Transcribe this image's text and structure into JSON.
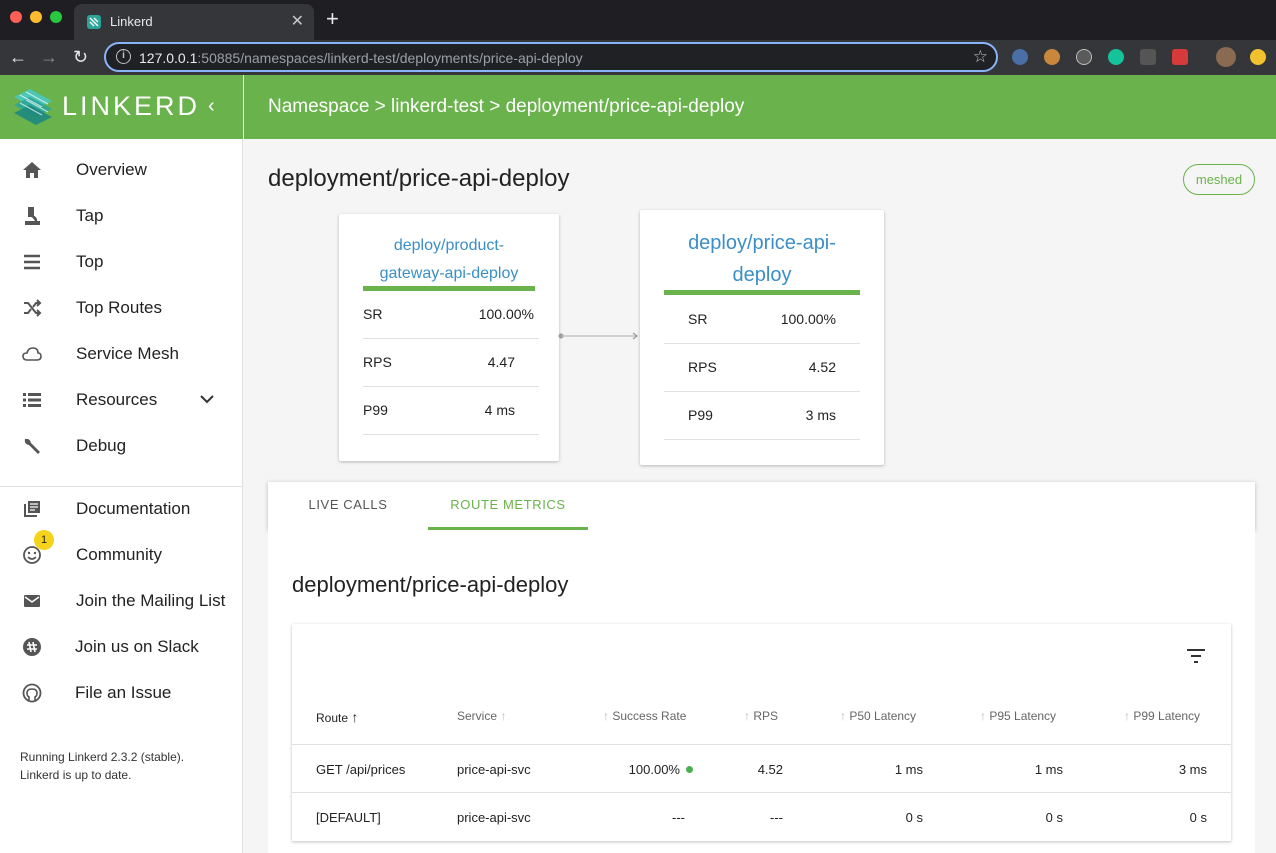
{
  "browser": {
    "tab_title": "Linkerd",
    "url_host": "127.0.0.1",
    "url_rest": ":50885/namespaces/linkerd-test/deployments/price-api-deploy"
  },
  "sidebar": {
    "logo_text": "LINKERD",
    "items": [
      {
        "label": "Overview",
        "icon": "home-icon"
      },
      {
        "label": "Tap",
        "icon": "microscope-icon"
      },
      {
        "label": "Top",
        "icon": "list-lines-icon"
      },
      {
        "label": "Top Routes",
        "icon": "shuffle-icon"
      },
      {
        "label": "Service Mesh",
        "icon": "cloud-icon"
      },
      {
        "label": "Resources",
        "icon": "list-icon"
      },
      {
        "label": "Debug",
        "icon": "wrench-icon"
      }
    ],
    "links": [
      {
        "label": "Documentation",
        "icon": "library-icon"
      },
      {
        "label": "Community",
        "icon": "smiley-icon",
        "badge": "1"
      },
      {
        "label": "Join the Mailing List",
        "icon": "mail-icon"
      },
      {
        "label": "Join us on Slack",
        "icon": "slack-icon"
      },
      {
        "label": "File an Issue",
        "icon": "github-icon"
      }
    ],
    "version_line1": "Running Linkerd 2.3.2 (stable).",
    "version_line2": "Linkerd is up to date."
  },
  "header": {
    "breadcrumb": "Namespace > linkerd-test > deployment/price-api-deploy"
  },
  "page": {
    "title": "deployment/price-api-deploy",
    "meshed_label": "meshed"
  },
  "graph": {
    "source": {
      "title_line1": "deploy/product-",
      "title_line2": "gateway-api-deploy",
      "metrics": [
        {
          "name": "SR",
          "value": "100.00%"
        },
        {
          "name": "RPS",
          "value": "4.47"
        },
        {
          "name": "P99",
          "value": "4 ms"
        }
      ]
    },
    "target": {
      "title_line1": "deploy/price-api-",
      "title_line2": "deploy",
      "metrics": [
        {
          "name": "SR",
          "value": "100.00%"
        },
        {
          "name": "RPS",
          "value": "4.52"
        },
        {
          "name": "P99",
          "value": "3 ms"
        }
      ]
    }
  },
  "tabs": {
    "live_calls": "LIVE CALLS",
    "route_metrics": "ROUTE METRICS"
  },
  "routes": {
    "title": "deployment/price-api-deploy",
    "columns": [
      "Route",
      "Service",
      "Success Rate",
      "RPS",
      "P50 Latency",
      "P95 Latency",
      "P99 Latency"
    ],
    "rows": [
      {
        "route": "GET /api/prices",
        "service": "price-api-svc",
        "success_rate": "100.00%",
        "rps": "4.52",
        "p50": "1 ms",
        "p95": "1 ms",
        "p99": "3 ms"
      },
      {
        "route": "[DEFAULT]",
        "service": "price-api-svc",
        "success_rate": "---",
        "rps": "---",
        "p50": "0 s",
        "p95": "0 s",
        "p99": "0 s"
      }
    ]
  },
  "colors": {
    "brand_green": "#6ab24b",
    "link_blue": "#3a8fc8",
    "status_green": "#4caf50"
  }
}
